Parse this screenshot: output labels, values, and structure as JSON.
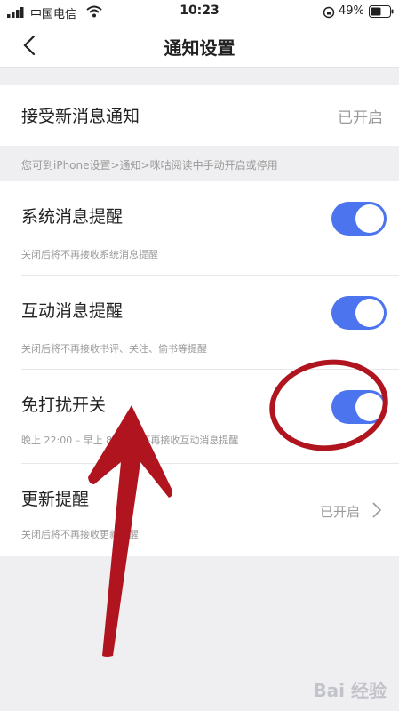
{
  "status_bar": {
    "carrier": "中国电信",
    "time": "10:23",
    "battery": "49%"
  },
  "nav": {
    "title": "通知设置"
  },
  "new_message": {
    "label": "接受新消息通知",
    "value": "已开启"
  },
  "tip": "您可到iPhone设置>通知>咪咕阅读中手动开启或停用",
  "settings": [
    {
      "label": "系统消息提醒",
      "hint": "关闭后将不再接收系统消息提醒",
      "enabled": true
    },
    {
      "label": "互动消息提醒",
      "hint": "关闭后将不再接收书评、关注、偷书等提醒",
      "enabled": true
    },
    {
      "label": "免打扰开关",
      "hint": "晚上 22:00 – 早上 8:00 将不再接收互动消息提醒",
      "enabled": true
    }
  ],
  "update_reminder": {
    "label": "更新提醒",
    "hint": "关闭后将不再接收更新提醒",
    "value": "已开启"
  },
  "colors": {
    "toggle_on": "#4c74ee",
    "annotation": "#b0141e"
  },
  "watermark": "Bai 经验"
}
